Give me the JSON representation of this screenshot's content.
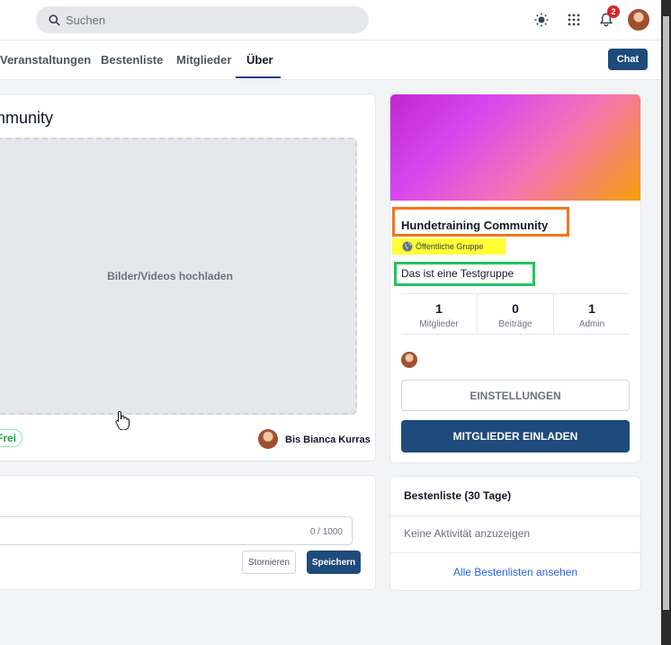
{
  "header": {
    "search_placeholder": "Suchen",
    "notification_count": "2",
    "icons": [
      "search-icon",
      "sun-icon",
      "apps-grid-icon",
      "bell-icon",
      "user-avatar"
    ]
  },
  "subnav": {
    "tabs": [
      {
        "label": "Veranstaltungen"
      },
      {
        "label": "Bestenliste"
      },
      {
        "label": "Mitglieder"
      },
      {
        "label": "Über",
        "active": true
      }
    ],
    "chat_label": "Chat"
  },
  "main": {
    "title": "mmunity",
    "upload_label": "Bilder/Videos hochladen",
    "price_tag": "Frei",
    "host": "Bis Bianca Kurras"
  },
  "note": {
    "counter": "0 / 1000",
    "cancel_label": "Stornieren",
    "save_label": "Speichern"
  },
  "group": {
    "name": "Hundetraining Community",
    "visibility": "Öffentliche Gruppe",
    "description": "Das ist eine Testgruppe",
    "stats": [
      {
        "value": "1",
        "label": "Mitglieder"
      },
      {
        "value": "0",
        "label": "Beiträge"
      },
      {
        "value": "1",
        "label": "Admin"
      }
    ],
    "settings_label": "EINSTELLUNGEN",
    "invite_label": "MITGLIEDER EINLADEN"
  },
  "leaderboard": {
    "title": "Bestenliste (30 Tage)",
    "empty": "Keine Aktivität anzuzeigen",
    "link": "Alle Bestenlisten ansehen"
  },
  "colors": {
    "primary": "#1e4a7c",
    "highlight_orange": "#f97316",
    "highlight_yellow": "#ffff33",
    "highlight_green": "#22c55e",
    "badge_red": "#dc2626"
  }
}
